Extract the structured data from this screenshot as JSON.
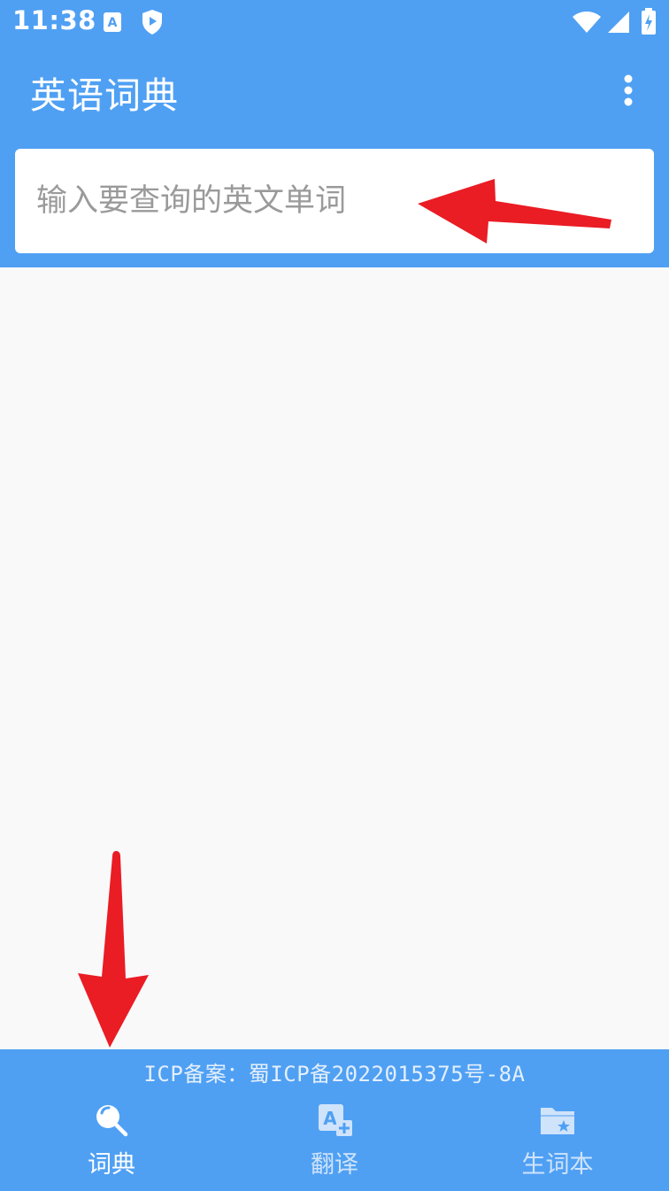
{
  "status_bar": {
    "time": "11:38",
    "icons": [
      "a-notification-icon",
      "shield-play-icon",
      "wifi-icon",
      "signal-icon",
      "battery-charging-icon"
    ]
  },
  "app_bar": {
    "title": "英语词典",
    "overflow_icon": "more-vertical-icon"
  },
  "search": {
    "placeholder": "输入要查询的英文单词",
    "value": ""
  },
  "annotations": {
    "arrow_color": "#ea1c24"
  },
  "footer": {
    "icp": "ICP备案：蜀ICP备2022015375号-8A"
  },
  "bottom_nav": {
    "items": [
      {
        "label": "词典",
        "icon": "search-icon",
        "active": true
      },
      {
        "label": "翻译",
        "icon": "translate-icon",
        "active": false
      },
      {
        "label": "生词本",
        "icon": "folder-star-icon",
        "active": false
      }
    ]
  },
  "colors": {
    "primary": "#4fa0f3",
    "background": "#f9f9f9",
    "nav_active": "#ffffff",
    "nav_inactive": "#cfe3fb"
  }
}
